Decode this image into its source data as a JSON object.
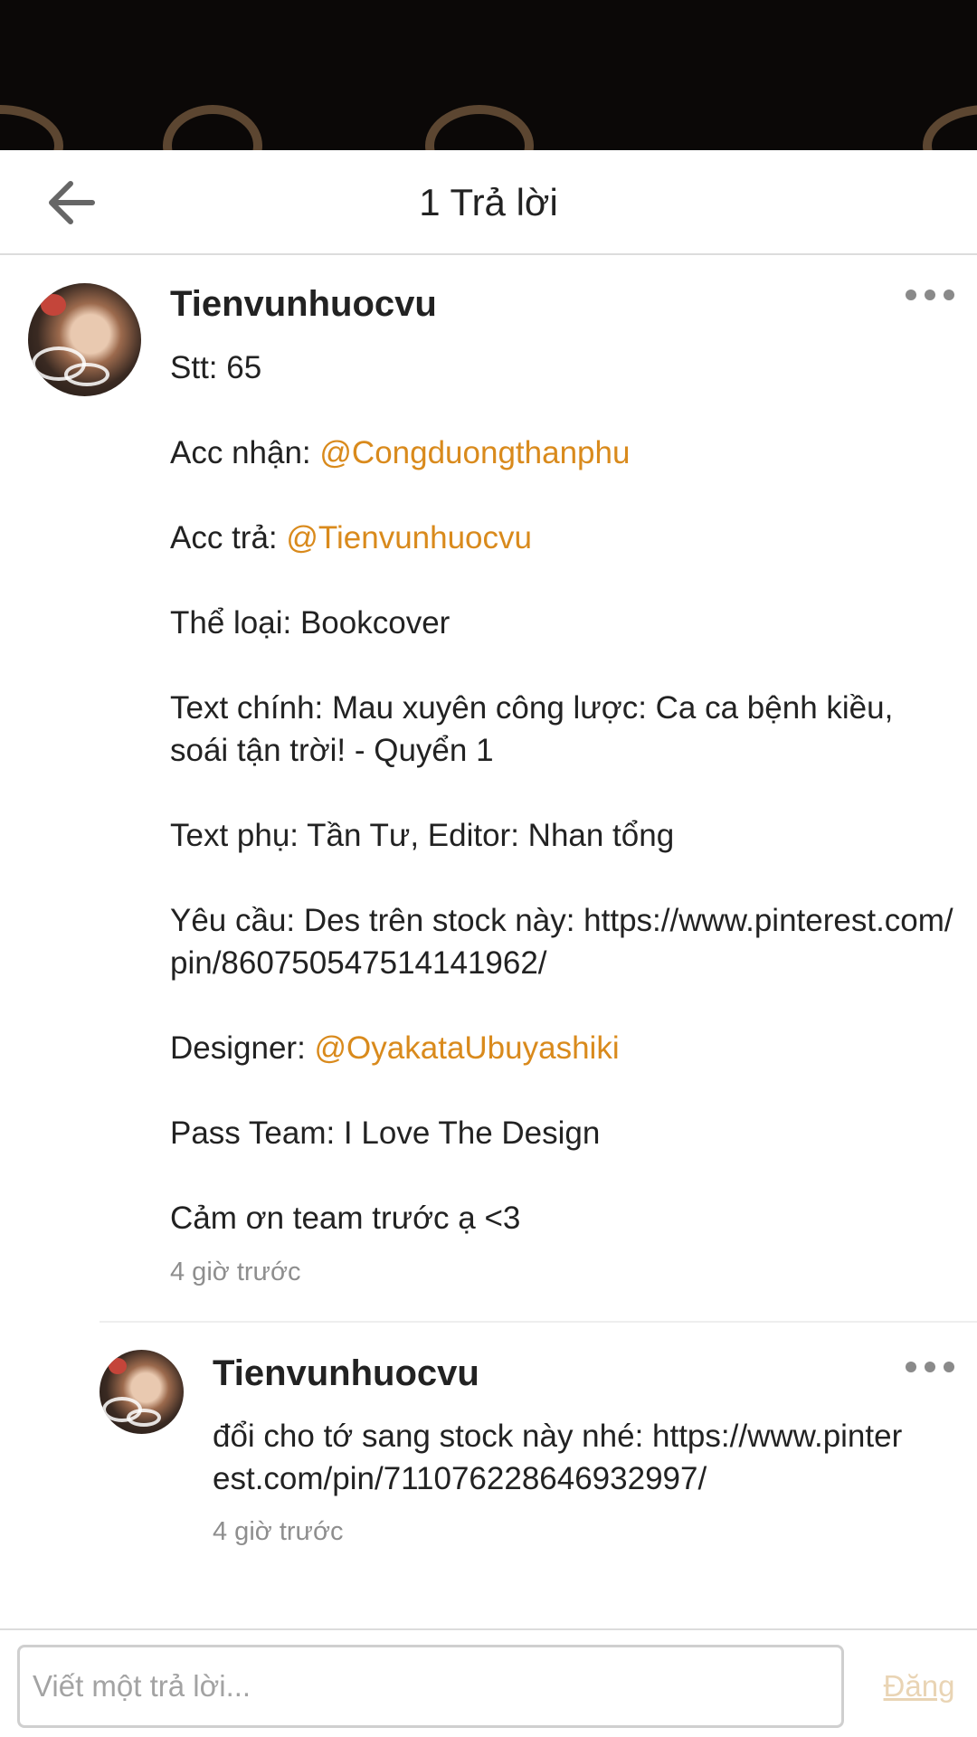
{
  "header": {
    "title": "1 Trả lời",
    "back_icon": "arrow-left-icon"
  },
  "post": {
    "author": "Tienvunhuocvu",
    "lines": [
      {
        "text": "Stt: 65",
        "mention": ""
      },
      {
        "text": "Acc nhận: ",
        "mention": "@Congduongthanphu"
      },
      {
        "text": "Acc trả: ",
        "mention": "@Tienvunhuocvu"
      },
      {
        "text": "Thể loại: Bookcover",
        "mention": ""
      },
      {
        "text": "Text chính: Mau xuyên công lược: Ca ca bệnh kiều, soái tận trời! - Quyển 1",
        "mention": ""
      },
      {
        "text": "Text phụ: Tần Tư, Editor: Nhan tổng",
        "mention": ""
      },
      {
        "text": "Yêu cầu: Des trên stock này: https://www.pinterest.com/pin/860750547514141962/",
        "mention": ""
      },
      {
        "text": "Designer: ",
        "mention": "@OyakataUbuyashiki"
      },
      {
        "text": "Pass Team: I Love The Design",
        "mention": ""
      },
      {
        "text": "Cảm ơn team trước ạ <3",
        "mention": ""
      }
    ],
    "time": "4 giờ trước"
  },
  "reply": {
    "author": "Tienvunhuocvu",
    "text": "đổi cho tớ sang stock này nhé: https://www.pinterest.com/pin/711076228646932997/",
    "time": "4 giờ trước"
  },
  "composer": {
    "placeholder": "Viết một trả lời...",
    "submit_label": "Đăng"
  },
  "colors": {
    "mention": "#d98a1c",
    "disabled_submit": "#e9d4b4",
    "banner": "#0b0807"
  }
}
